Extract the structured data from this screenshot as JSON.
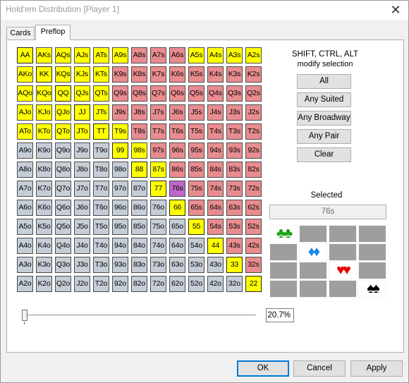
{
  "window": {
    "title": "Hold'em Distribution [Player 1]",
    "close_glyph": "✕"
  },
  "tabs": [
    {
      "label": "Cards"
    },
    {
      "label": "Preflop"
    }
  ],
  "grid": {
    "rows": [
      [
        [
          "AA",
          "y"
        ],
        [
          "AKs",
          "y"
        ],
        [
          "AQs",
          "y"
        ],
        [
          "AJs",
          "y"
        ],
        [
          "ATs",
          "y"
        ],
        [
          "A9s",
          "y"
        ],
        [
          "A8s",
          "r"
        ],
        [
          "A7s",
          "r"
        ],
        [
          "A6s",
          "r"
        ],
        [
          "A5s",
          "y"
        ],
        [
          "A4s",
          "y"
        ],
        [
          "A3s",
          "y"
        ],
        [
          "A2s",
          "y"
        ]
      ],
      [
        [
          "AKo",
          "y"
        ],
        [
          "KK",
          "y"
        ],
        [
          "KQs",
          "y"
        ],
        [
          "KJs",
          "y"
        ],
        [
          "KTs",
          "y"
        ],
        [
          "K9s",
          "r"
        ],
        [
          "K8s",
          "r"
        ],
        [
          "K7s",
          "r"
        ],
        [
          "K6s",
          "r"
        ],
        [
          "K5s",
          "r"
        ],
        [
          "K4s",
          "r"
        ],
        [
          "K3s",
          "r"
        ],
        [
          "K2s",
          "r"
        ]
      ],
      [
        [
          "AQo",
          "y"
        ],
        [
          "KQo",
          "y"
        ],
        [
          "QQ",
          "y"
        ],
        [
          "QJs",
          "y"
        ],
        [
          "QTs",
          "y"
        ],
        [
          "Q9s",
          "r"
        ],
        [
          "Q8s",
          "r"
        ],
        [
          "Q7s",
          "r"
        ],
        [
          "Q6s",
          "r"
        ],
        [
          "Q5s",
          "r"
        ],
        [
          "Q4s",
          "r"
        ],
        [
          "Q3s",
          "r"
        ],
        [
          "Q2s",
          "r"
        ]
      ],
      [
        [
          "AJo",
          "y"
        ],
        [
          "KJo",
          "y"
        ],
        [
          "QJo",
          "y"
        ],
        [
          "JJ",
          "y"
        ],
        [
          "JTs",
          "y"
        ],
        [
          "J9s",
          "r"
        ],
        [
          "J8s",
          "r"
        ],
        [
          "J7s",
          "r"
        ],
        [
          "J6s",
          "r"
        ],
        [
          "J5s",
          "r"
        ],
        [
          "J4s",
          "r"
        ],
        [
          "J3s",
          "r"
        ],
        [
          "J2s",
          "r"
        ]
      ],
      [
        [
          "ATo",
          "y"
        ],
        [
          "KTo",
          "y"
        ],
        [
          "QTo",
          "y"
        ],
        [
          "JTo",
          "y"
        ],
        [
          "TT",
          "y"
        ],
        [
          "T9s",
          "y"
        ],
        [
          "T8s",
          "r"
        ],
        [
          "T7s",
          "r"
        ],
        [
          "T6s",
          "r"
        ],
        [
          "T5s",
          "r"
        ],
        [
          "T4s",
          "r"
        ],
        [
          "T3s",
          "r"
        ],
        [
          "T2s",
          "r"
        ]
      ],
      [
        [
          "A9o",
          "g"
        ],
        [
          "K9o",
          "g"
        ],
        [
          "Q9o",
          "g"
        ],
        [
          "J9o",
          "g"
        ],
        [
          "T9o",
          "g"
        ],
        [
          "99",
          "y"
        ],
        [
          "98s",
          "y"
        ],
        [
          "97s",
          "r"
        ],
        [
          "96s",
          "r"
        ],
        [
          "95s",
          "r"
        ],
        [
          "94s",
          "r"
        ],
        [
          "93s",
          "r"
        ],
        [
          "92s",
          "r"
        ]
      ],
      [
        [
          "A8o",
          "g"
        ],
        [
          "K8o",
          "g"
        ],
        [
          "Q8o",
          "g"
        ],
        [
          "J8o",
          "g"
        ],
        [
          "T8o",
          "g"
        ],
        [
          "98o",
          "g"
        ],
        [
          "88",
          "y"
        ],
        [
          "87s",
          "y"
        ],
        [
          "86s",
          "r"
        ],
        [
          "85s",
          "r"
        ],
        [
          "84s",
          "r"
        ],
        [
          "83s",
          "r"
        ],
        [
          "82s",
          "r"
        ]
      ],
      [
        [
          "A7o",
          "g"
        ],
        [
          "K7o",
          "g"
        ],
        [
          "Q7o",
          "g"
        ],
        [
          "J7o",
          "g"
        ],
        [
          "T7o",
          "g"
        ],
        [
          "97o",
          "g"
        ],
        [
          "87o",
          "g"
        ],
        [
          "77",
          "y"
        ],
        [
          "76s",
          "p"
        ],
        [
          "75s",
          "r"
        ],
        [
          "74s",
          "r"
        ],
        [
          "73s",
          "r"
        ],
        [
          "72s",
          "r"
        ]
      ],
      [
        [
          "A6o",
          "g"
        ],
        [
          "K6o",
          "g"
        ],
        [
          "Q6o",
          "g"
        ],
        [
          "J6o",
          "g"
        ],
        [
          "T6o",
          "g"
        ],
        [
          "96o",
          "g"
        ],
        [
          "86o",
          "g"
        ],
        [
          "76o",
          "g"
        ],
        [
          "66",
          "y"
        ],
        [
          "65s",
          "r"
        ],
        [
          "64s",
          "r"
        ],
        [
          "63s",
          "r"
        ],
        [
          "62s",
          "r"
        ]
      ],
      [
        [
          "A5o",
          "g"
        ],
        [
          "K5o",
          "g"
        ],
        [
          "Q5o",
          "g"
        ],
        [
          "J5o",
          "g"
        ],
        [
          "T5o",
          "g"
        ],
        [
          "95o",
          "g"
        ],
        [
          "85o",
          "g"
        ],
        [
          "75o",
          "g"
        ],
        [
          "65o",
          "g"
        ],
        [
          "55",
          "y"
        ],
        [
          "54s",
          "r"
        ],
        [
          "53s",
          "r"
        ],
        [
          "52s",
          "r"
        ]
      ],
      [
        [
          "A4o",
          "g"
        ],
        [
          "K4o",
          "g"
        ],
        [
          "Q4o",
          "g"
        ],
        [
          "J4o",
          "g"
        ],
        [
          "T4o",
          "g"
        ],
        [
          "94o",
          "g"
        ],
        [
          "84o",
          "g"
        ],
        [
          "74o",
          "g"
        ],
        [
          "64o",
          "g"
        ],
        [
          "54o",
          "g"
        ],
        [
          "44",
          "y"
        ],
        [
          "43s",
          "r"
        ],
        [
          "42s",
          "r"
        ]
      ],
      [
        [
          "A3o",
          "g"
        ],
        [
          "K3o",
          "g"
        ],
        [
          "Q3o",
          "g"
        ],
        [
          "J3o",
          "g"
        ],
        [
          "T3o",
          "g"
        ],
        [
          "93o",
          "g"
        ],
        [
          "83o",
          "g"
        ],
        [
          "73o",
          "g"
        ],
        [
          "63o",
          "g"
        ],
        [
          "53o",
          "g"
        ],
        [
          "43o",
          "g"
        ],
        [
          "33",
          "y"
        ],
        [
          "32s",
          "r"
        ]
      ],
      [
        [
          "A2o",
          "g"
        ],
        [
          "K2o",
          "g"
        ],
        [
          "Q2o",
          "g"
        ],
        [
          "J2o",
          "g"
        ],
        [
          "T2o",
          "g"
        ],
        [
          "92o",
          "g"
        ],
        [
          "82o",
          "g"
        ],
        [
          "72o",
          "g"
        ],
        [
          "62o",
          "g"
        ],
        [
          "52o",
          "g"
        ],
        [
          "42o",
          "g"
        ],
        [
          "32o",
          "g"
        ],
        [
          "22",
          "y"
        ]
      ]
    ],
    "colors": {
      "selected": "#ffff00",
      "unselected_suited": "#e88c90",
      "unselected_offsuit": "#c5cdd6",
      "current": "#c068c8"
    }
  },
  "sidebar": {
    "hint_line1": "SHIFT, CTRL, ALT",
    "hint_line2": "modify selection",
    "buttons": {
      "all": "All",
      "any_suited": "Any Suited",
      "any_broadway": "Any Broadway",
      "any_pair": "Any Pair",
      "clear": "Clear"
    }
  },
  "selected": {
    "label": "Selected",
    "value": "76s",
    "suits": {
      "row0": {
        "symbol": "♣♣",
        "color": "#1aa31a",
        "icon": "clubs-icon"
      },
      "row1": {
        "symbol": "♦♦",
        "color": "#1e88e5",
        "icon": "diamonds-icon"
      },
      "row2": {
        "symbol": "♥♥",
        "color": "#e00000",
        "icon": "hearts-icon"
      },
      "row3": {
        "symbol": "♠♠",
        "color": "#000000",
        "icon": "spades-icon"
      }
    }
  },
  "range": {
    "percent_text": "20.7%"
  },
  "footer": {
    "ok": "OK",
    "cancel": "Cancel",
    "apply": "Apply"
  }
}
